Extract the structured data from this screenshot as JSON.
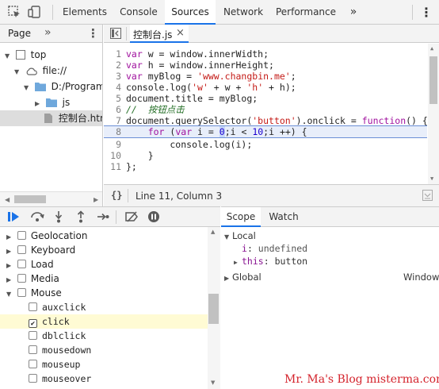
{
  "toolbar": {
    "tabs": [
      "Elements",
      "Console",
      "Sources",
      "Network",
      "Performance"
    ],
    "overflow": "»",
    "menu": "⋮"
  },
  "navigator": {
    "tab_label": "Page",
    "overflow": "»",
    "menu": "⋮",
    "tree": [
      {
        "label": "top"
      },
      {
        "label": "file://"
      },
      {
        "label": "D:/Program%"
      },
      {
        "label": "js"
      },
      {
        "label": "控制台.htm"
      }
    ]
  },
  "editor": {
    "file_tab": "控制台.js",
    "close": "×",
    "lines": [
      {
        "n": "1"
      },
      {
        "n": "2"
      },
      {
        "n": "3"
      },
      {
        "n": "4"
      },
      {
        "n": "5"
      },
      {
        "n": "6"
      },
      {
        "n": "7"
      },
      {
        "n": "8"
      },
      {
        "n": "9"
      },
      {
        "n": "10"
      },
      {
        "n": "11"
      }
    ],
    "code": {
      "l1_kw": "var",
      "l1_rest": " w = window.innerWidth;",
      "l2_kw": "var",
      "l2_rest": " h = window.innerHeight;",
      "l3_kw": "var",
      "l3_mid": " myBlog = ",
      "l3_str": "'www.changbin.me'",
      "l3_end": ";",
      "l4_a": "console.log(",
      "l4_s1": "'w'",
      "l4_b": " + w + ",
      "l4_s2": "'h'",
      "l4_c": " + h);",
      "l5": "document.title = myBlog;",
      "l6": "//  按钮点击",
      "l7_a": "document.querySelector(",
      "l7_s": "'button'",
      "l7_b": ").onclick = ",
      "l7_kw": "function",
      "l7_c": "() {",
      "l8_pre": "    ",
      "l8_for": "for",
      "l8_a": " (",
      "l8_var": "var",
      "l8_b": " i = ",
      "l8_n0": "0",
      "l8_c": ";i < ",
      "l8_n10": "10",
      "l8_d": ";i ++) {",
      "l9": "        console.log(i);",
      "l10": "    }",
      "l11": "};"
    },
    "status_text": "Line 11, Column 3",
    "format_icon": "{}"
  },
  "breakpoints": {
    "items": [
      {
        "label": "Geolocation",
        "checked": false,
        "expanded": false
      },
      {
        "label": "Keyboard",
        "checked": false,
        "expanded": false
      },
      {
        "label": "Load",
        "checked": false,
        "expanded": false
      },
      {
        "label": "Media",
        "checked": false,
        "expanded": false
      },
      {
        "label": "Mouse",
        "checked": false,
        "expanded": true
      }
    ],
    "mouse_events": [
      {
        "label": "auxclick",
        "checked": false
      },
      {
        "label": "click",
        "checked": true
      },
      {
        "label": "dblclick",
        "checked": false
      },
      {
        "label": "mousedown",
        "checked": false
      },
      {
        "label": "mouseup",
        "checked": false
      },
      {
        "label": "mouseover",
        "checked": false
      }
    ]
  },
  "scope": {
    "tabs": [
      "Scope",
      "Watch"
    ],
    "local_label": "Local",
    "local_vars": [
      {
        "name": "i",
        "value": "undefined"
      },
      {
        "name": "this",
        "value": "button"
      }
    ],
    "global_label": "Global",
    "global_value": "Window"
  },
  "watermark": "Mr. Ma's Blog  misterma.com",
  "colors": {
    "accent": "#1a73e8",
    "watermark": "#d4232c"
  }
}
